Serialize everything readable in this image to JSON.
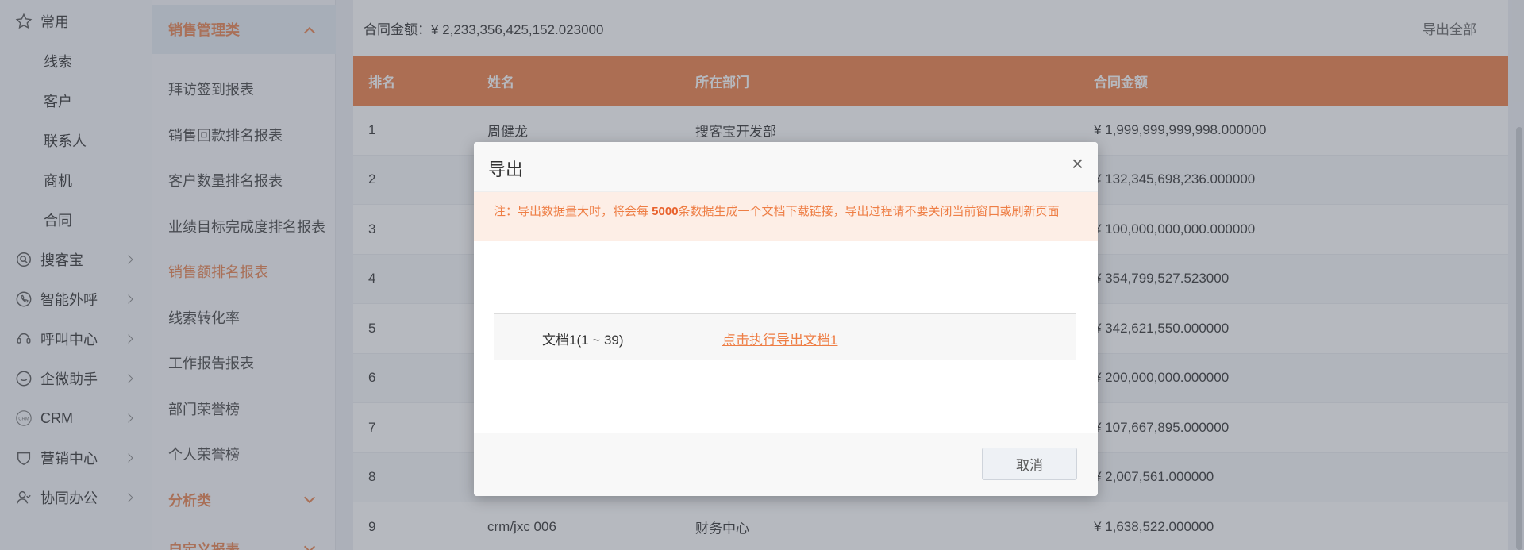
{
  "nav": {
    "items": [
      {
        "label": "常用",
        "icon": "star-icon",
        "chevron": false,
        "sub": false
      },
      {
        "label": "线索",
        "icon": "",
        "chevron": false,
        "sub": true
      },
      {
        "label": "客户",
        "icon": "",
        "chevron": false,
        "sub": true
      },
      {
        "label": "联系人",
        "icon": "",
        "chevron": false,
        "sub": true
      },
      {
        "label": "商机",
        "icon": "",
        "chevron": false,
        "sub": true
      },
      {
        "label": "合同",
        "icon": "",
        "chevron": false,
        "sub": true
      },
      {
        "label": "搜客宝",
        "icon": "search-target-icon",
        "chevron": true,
        "sub": false
      },
      {
        "label": "智能外呼",
        "icon": "phone-circle-icon",
        "chevron": true,
        "sub": false
      },
      {
        "label": "呼叫中心",
        "icon": "headset-icon",
        "chevron": true,
        "sub": false
      },
      {
        "label": "企微助手",
        "icon": "chat-icon",
        "chevron": true,
        "sub": false
      },
      {
        "label": "CRM",
        "icon": "crm-icon",
        "chevron": true,
        "sub": false
      },
      {
        "label": "营销中心",
        "icon": "heart-shield-icon",
        "chevron": true,
        "sub": false
      },
      {
        "label": "协同办公",
        "icon": "user-icon",
        "chevron": true,
        "sub": false
      }
    ]
  },
  "menu2": {
    "cat_sales": "销售管理类",
    "items": [
      "拜访签到报表",
      "销售回款排名报表",
      "客户数量排名报表",
      "业绩目标完成度排名报表",
      "销售额排名报表",
      "线索转化率",
      "工作报告报表",
      "部门荣誉榜",
      "个人荣誉榜"
    ],
    "active_index": 4,
    "cat_analysis": "分析类",
    "cat_custom": "自定义报表"
  },
  "summary": {
    "amount_text": "合同金额：¥ 2,233,356,425,152.023000",
    "export_all": "导出全部"
  },
  "table": {
    "headers": [
      "排名",
      "姓名",
      "所在部门",
      "合同金额"
    ],
    "rows": [
      [
        "1",
        "周健龙",
        "搜客宝开发部",
        "¥ 1,999,999,999,998.000000"
      ],
      [
        "2",
        "",
        "",
        "¥ 132,345,698,236.000000"
      ],
      [
        "3",
        "",
        "",
        "¥ 100,000,000,000.000000"
      ],
      [
        "4",
        "",
        "",
        "¥ 354,799,527.523000"
      ],
      [
        "5",
        "",
        "",
        "¥ 342,621,550.000000"
      ],
      [
        "6",
        "",
        "",
        "¥ 200,000,000.000000"
      ],
      [
        "7",
        "",
        "",
        "¥ 107,667,895.000000"
      ],
      [
        "8",
        "",
        "",
        "¥ 2,007,561.000000"
      ],
      [
        "9",
        "crm/jxc 006",
        "财务中心",
        "¥ 1,638,522.000000"
      ]
    ]
  },
  "modal": {
    "title": "导出",
    "close": "×",
    "notice_prefix": "注：导出数据量大时，将会每 ",
    "notice_bold": "5000",
    "notice_suffix": "条数据生成一个文档下载链接，导出过程请不要关闭当前窗口或刷新页面",
    "doc_name": "文档1(1 ~ 39)",
    "doc_link": "点击执行导出文档1",
    "cancel": "取消"
  },
  "colors": {
    "accent": "#ee7e45",
    "header_bg": "#ee7e45",
    "overlay": "rgba(80,88,102,0.42)"
  }
}
